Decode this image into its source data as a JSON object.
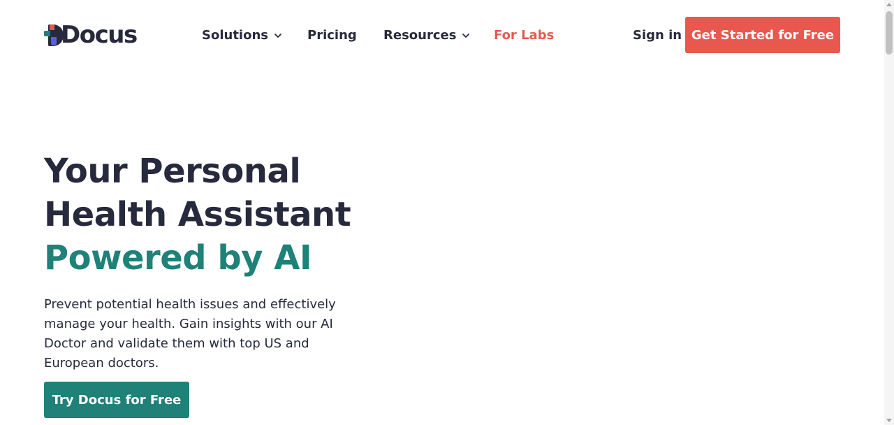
{
  "brand": {
    "name": "Docus",
    "colors": {
      "primary": "#1f8178",
      "accent": "#e8584f",
      "dark": "#262a3c",
      "logo_blue": "#5b5ce8"
    }
  },
  "nav": {
    "items": [
      {
        "label": "Solutions",
        "has_dropdown": true,
        "icon": "chevron-down-icon"
      },
      {
        "label": "Pricing",
        "has_dropdown": false
      },
      {
        "label": "Resources",
        "has_dropdown": true,
        "icon": "chevron-down-icon"
      },
      {
        "label": "For Labs",
        "has_dropdown": false
      }
    ],
    "sign_in": "Sign in",
    "cta": "Get Started for Free"
  },
  "hero": {
    "title_line1": "Your Personal",
    "title_line2": "Health Assistant",
    "title_accent": "Powered by AI",
    "description": "Prevent potential health issues and effectively manage your health. Gain insights with our AI Doctor and validate them with top US and European doctors.",
    "cta": "Try Docus for Free"
  }
}
